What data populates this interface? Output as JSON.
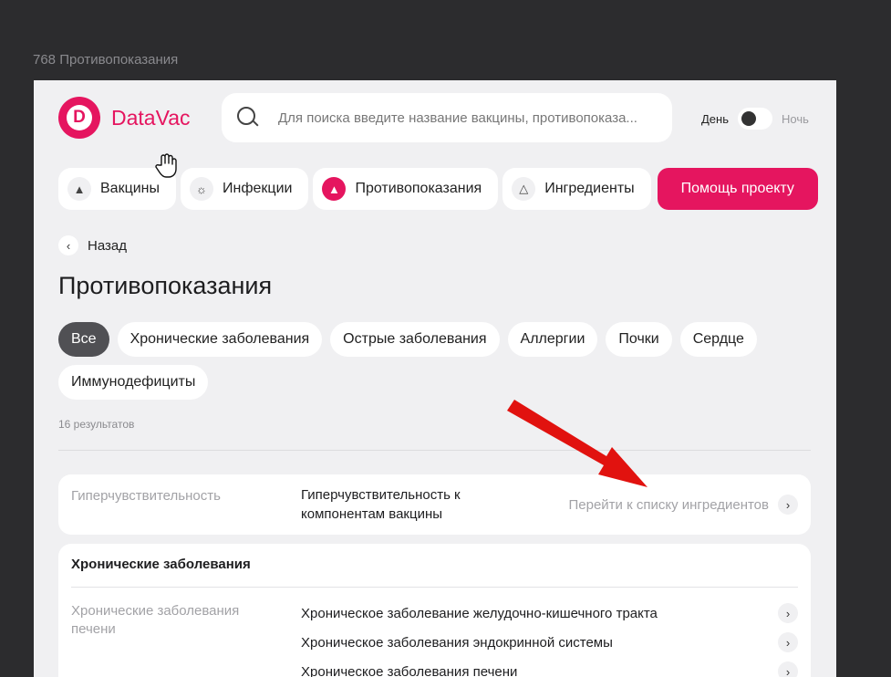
{
  "frame_label": "768 Противопоказания",
  "brand": {
    "name": "DataVac",
    "mark": "D",
    "color": "#e5155f"
  },
  "search": {
    "placeholder": "Для поиска введите название вакцины, противопоказа..."
  },
  "theme": {
    "day_label": "День",
    "night_label": "Ночь"
  },
  "nav": {
    "items": [
      {
        "label": "Вакцины",
        "icon": "vial-icon"
      },
      {
        "label": "Инфекции",
        "icon": "virus-icon"
      },
      {
        "label": "Противопоказания",
        "icon": "vial-icon",
        "active": true
      },
      {
        "label": "Ингредиенты",
        "icon": "flask-icon"
      }
    ],
    "cta_label": "Помощь проекту"
  },
  "back_label": "Назад",
  "page_title": "Противопоказания",
  "filters": [
    "Все",
    "Хронические заболевания",
    "Острые заболевания",
    "Аллергии",
    "Почки",
    "Сердце",
    "Иммунодефициты"
  ],
  "active_filter": "Все",
  "results_text": "16 результатов",
  "cards": [
    {
      "category": "Гиперчувствительность",
      "description_lines": [
        "Гиперчувствительность к",
        "компонентам вакцины"
      ],
      "link_label": "Перейти к списку ингредиентов"
    }
  ],
  "group": {
    "title": "Хронические заболевания",
    "category_lines": [
      "Хронические заболевания",
      "печени"
    ],
    "items": [
      "Хроническое заболевание желудочно-кишечного тракта",
      "Хроническое заболевания эндокринной системы",
      "Хроническое заболевания печени"
    ]
  }
}
